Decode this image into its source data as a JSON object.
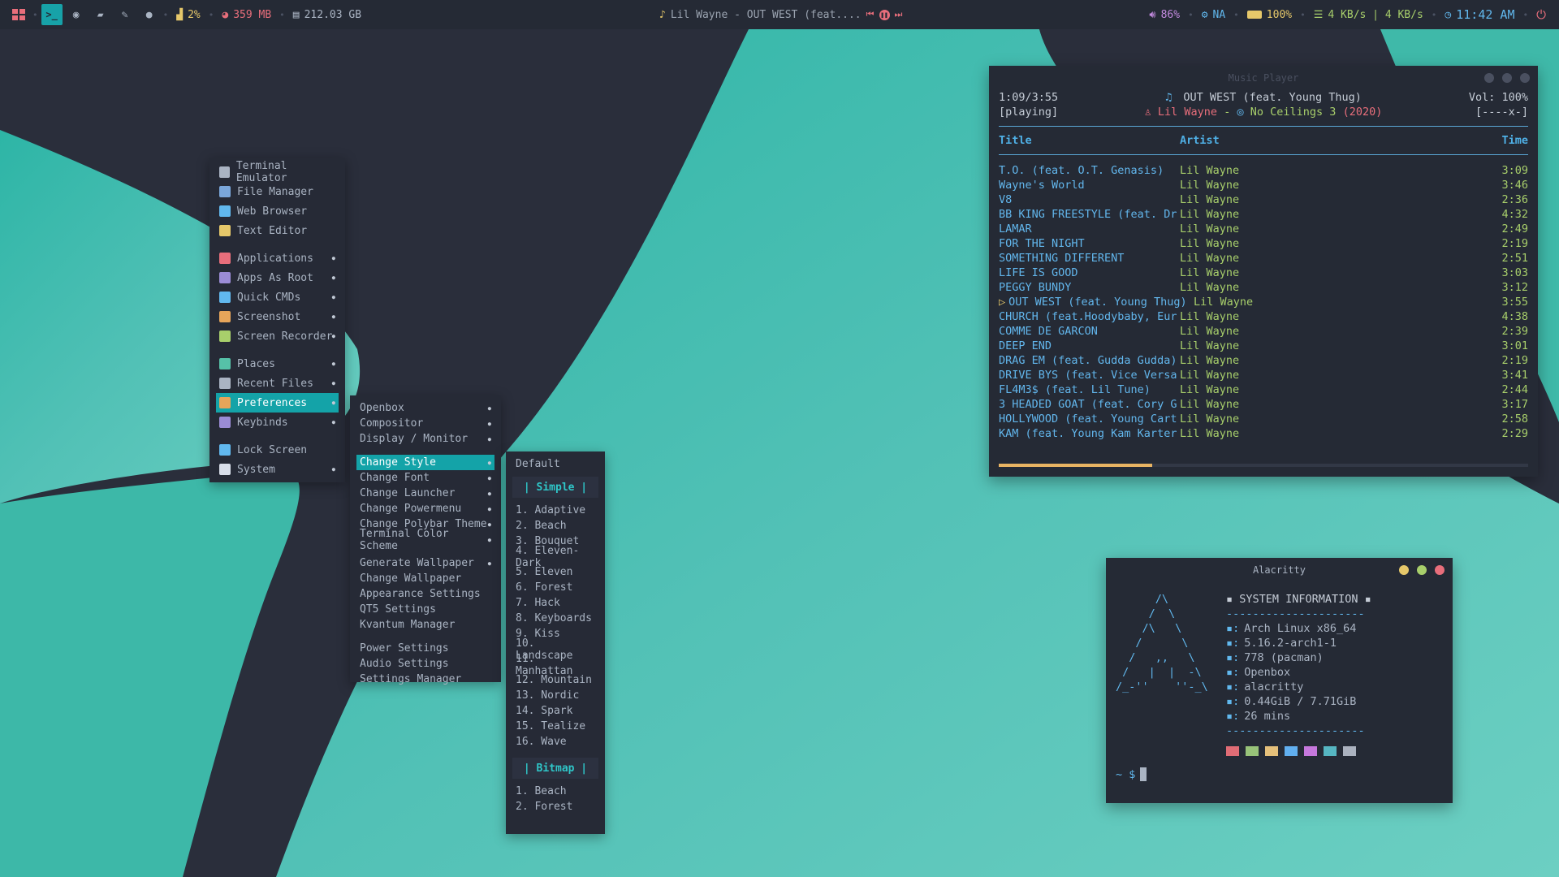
{
  "topbar": {
    "cpu": "2%",
    "memory": "359 MB",
    "disk": "212.03 GB",
    "now_playing": "Lil Wayne - OUT WEST (feat....",
    "volume": "86%",
    "network_name": "NA",
    "battery": "100%",
    "net_speed": "4 KB/s | 4 KB/s",
    "time": "11:42 AM",
    "icons": [
      "menu-grid-icon",
      "terminal-icon",
      "firefox-icon",
      "folder-icon",
      "editor-icon",
      "chat-icon",
      "cpu-chart-icon",
      "memory-pie-icon",
      "disk-icon",
      "music-note-icon",
      "prev-icon",
      "pause-icon",
      "next-icon",
      "volume-icon",
      "network-icon",
      "battery-icon",
      "net-speed-icon",
      "clock-icon",
      "power-icon"
    ],
    "colors": {
      "active_workspace": "#17a2a8",
      "cpu": "#e6c86a",
      "memory": "#e86e7b",
      "volume": "#c48be0",
      "network": "#61b8ee",
      "battery": "#e6c86a",
      "net_speed": "#a8cf6b",
      "time": "#61b8ee",
      "power": "#e86e7b"
    }
  },
  "main_menu": {
    "groups": [
      [
        {
          "label": "Terminal Emulator",
          "icon": "terminal-icon"
        },
        {
          "label": "File Manager",
          "icon": "file-manager-icon"
        },
        {
          "label": "Web Browser",
          "icon": "globe-icon"
        },
        {
          "label": "Text Editor",
          "icon": "pencil-icon"
        }
      ],
      [
        {
          "label": "Applications",
          "icon": "apps-grid-icon",
          "submenu": true
        },
        {
          "label": "Apps As Root",
          "icon": "root-icon",
          "submenu": true
        },
        {
          "label": "Quick CMDs",
          "icon": "wrench-icon",
          "submenu": true
        },
        {
          "label": "Screenshot",
          "icon": "screenshot-icon",
          "submenu": true
        },
        {
          "label": "Screen Recorder",
          "icon": "camera-icon",
          "submenu": true
        }
      ],
      [
        {
          "label": "Places",
          "icon": "places-icon",
          "submenu": true
        },
        {
          "label": "Recent Files",
          "icon": "recent-files-icon",
          "submenu": true
        },
        {
          "label": "Preferences",
          "icon": "gear-icon",
          "submenu": true,
          "selected": true
        },
        {
          "label": "Keybinds",
          "icon": "keyboard-icon",
          "submenu": true
        }
      ],
      [
        {
          "label": "Lock Screen",
          "icon": "lock-icon"
        },
        {
          "label": "System",
          "icon": "power-circle-icon",
          "submenu": true
        }
      ]
    ]
  },
  "preferences_menu": {
    "groups": [
      [
        {
          "label": "Openbox",
          "submenu": true
        },
        {
          "label": "Compositor",
          "submenu": true
        },
        {
          "label": "Display / Monitor",
          "submenu": true
        }
      ],
      [
        {
          "label": "Change Style",
          "submenu": true,
          "selected": true
        },
        {
          "label": "Change Font",
          "submenu": true
        },
        {
          "label": "Change Launcher",
          "submenu": true
        },
        {
          "label": "Change Powermenu",
          "submenu": true
        },
        {
          "label": "Change Polybar Theme",
          "submenu": true
        },
        {
          "label": "Terminal Color Scheme",
          "submenu": true
        }
      ],
      [
        {
          "label": "Generate Wallpaper",
          "submenu": true
        },
        {
          "label": "Change Wallpaper"
        },
        {
          "label": "Appearance Settings"
        },
        {
          "label": "QT5 Settings"
        },
        {
          "label": "Kvantum Manager"
        }
      ],
      [
        {
          "label": "Power Settings"
        },
        {
          "label": "Audio Settings"
        },
        {
          "label": "Settings Manager"
        }
      ]
    ]
  },
  "style_menu": {
    "default_label": "Default",
    "simple_header": "| Simple |",
    "simple": [
      "1. Adaptive",
      "2. Beach",
      "3. Bouquet",
      "4. Eleven-Dark",
      "5. Eleven",
      "6. Forest",
      "7. Hack",
      "8. Keyboards",
      "9. Kiss",
      "10. Landscape",
      "11. Manhattan",
      "12. Mountain",
      "13. Nordic",
      "14. Spark",
      "15. Tealize",
      "16. Wave"
    ],
    "bitmap_header": "| Bitmap |",
    "bitmap": [
      "1. Beach",
      "2. Forest"
    ]
  },
  "player": {
    "window_title": "Music Player",
    "position": "1:09/3:55",
    "state": "[playing]",
    "song": "OUT WEST (feat. Young Thug)",
    "artist": "Lil Wayne",
    "artist_sep": "-",
    "album": "No Ceilings 3",
    "year": "(2020)",
    "volume": "Vol: 100%",
    "flags": "[----x-]",
    "col_title": "Title",
    "col_artist": "Artist",
    "col_time": "Time",
    "playing_marker": "▷",
    "progress": 0.29,
    "tracks": [
      {
        "title": "T.O. (feat. O.T. Genasis)",
        "artist": "Lil Wayne",
        "time": "3:09"
      },
      {
        "title": "Wayne's World",
        "artist": "Lil Wayne",
        "time": "3:46"
      },
      {
        "title": "V8",
        "artist": "Lil Wayne",
        "time": "2:36"
      },
      {
        "title": "BB KING FREESTYLE (feat. Dr",
        "artist": "Lil Wayne",
        "time": "4:32"
      },
      {
        "title": "LAMAR",
        "artist": "Lil Wayne",
        "time": "2:49"
      },
      {
        "title": "FOR THE NIGHT",
        "artist": "Lil Wayne",
        "time": "2:19"
      },
      {
        "title": "SOMETHING DIFFERENT",
        "artist": "Lil Wayne",
        "time": "2:51"
      },
      {
        "title": "LIFE IS GOOD",
        "artist": "Lil Wayne",
        "time": "3:03"
      },
      {
        "title": "PEGGY BUNDY",
        "artist": "Lil Wayne",
        "time": "3:12"
      },
      {
        "title": "OUT WEST (feat. Young Thug)",
        "artist": "Lil Wayne",
        "time": "3:55",
        "playing": true
      },
      {
        "title": "CHURCH (feat.Hoodybaby, Eur",
        "artist": "Lil Wayne",
        "time": "4:38"
      },
      {
        "title": "COMME DE GARCON",
        "artist": "Lil Wayne",
        "time": "2:39"
      },
      {
        "title": "DEEP END",
        "artist": "Lil Wayne",
        "time": "3:01"
      },
      {
        "title": "DRAG EM (feat. Gudda Gudda)",
        "artist": "Lil Wayne",
        "time": "2:19"
      },
      {
        "title": "DRIVE BYS (feat. Vice Versa",
        "artist": "Lil Wayne",
        "time": "3:41"
      },
      {
        "title": "FL4M3$ (feat. Lil Tune)",
        "artist": "Lil Wayne",
        "time": "2:44"
      },
      {
        "title": "3 HEADED GOAT (feat. Cory G",
        "artist": "Lil Wayne",
        "time": "3:17"
      },
      {
        "title": "HOLLYWOOD (feat. Young Cart",
        "artist": "Lil Wayne",
        "time": "2:58"
      },
      {
        "title": "KAM (feat. Young Kam Karter",
        "artist": "Lil Wayne",
        "time": "2:29"
      }
    ]
  },
  "terminal": {
    "window_title": "Alacritty",
    "ascii_art": "      /\\\n     /  \\\n    /\\   \\\n   /      \\\n  /   ,,   \\\n /   |  |  -\\\n/_-''    ''-_\\",
    "header": "▪ SYSTEM INFORMATION ▪",
    "divider": "---------------------",
    "bullet": "▪:",
    "lines": [
      "Arch Linux x86_64",
      "5.16.2-arch1-1",
      "778 (pacman)",
      "Openbox",
      "alacritty",
      "0.44GiB / 7.71GiB",
      "26 mins"
    ],
    "swatches": [
      "#e06c75",
      "#98c379",
      "#e5c07b",
      "#61afef",
      "#c678dd",
      "#56b6c2",
      "#abb2bf"
    ],
    "prompt": "~ $"
  }
}
